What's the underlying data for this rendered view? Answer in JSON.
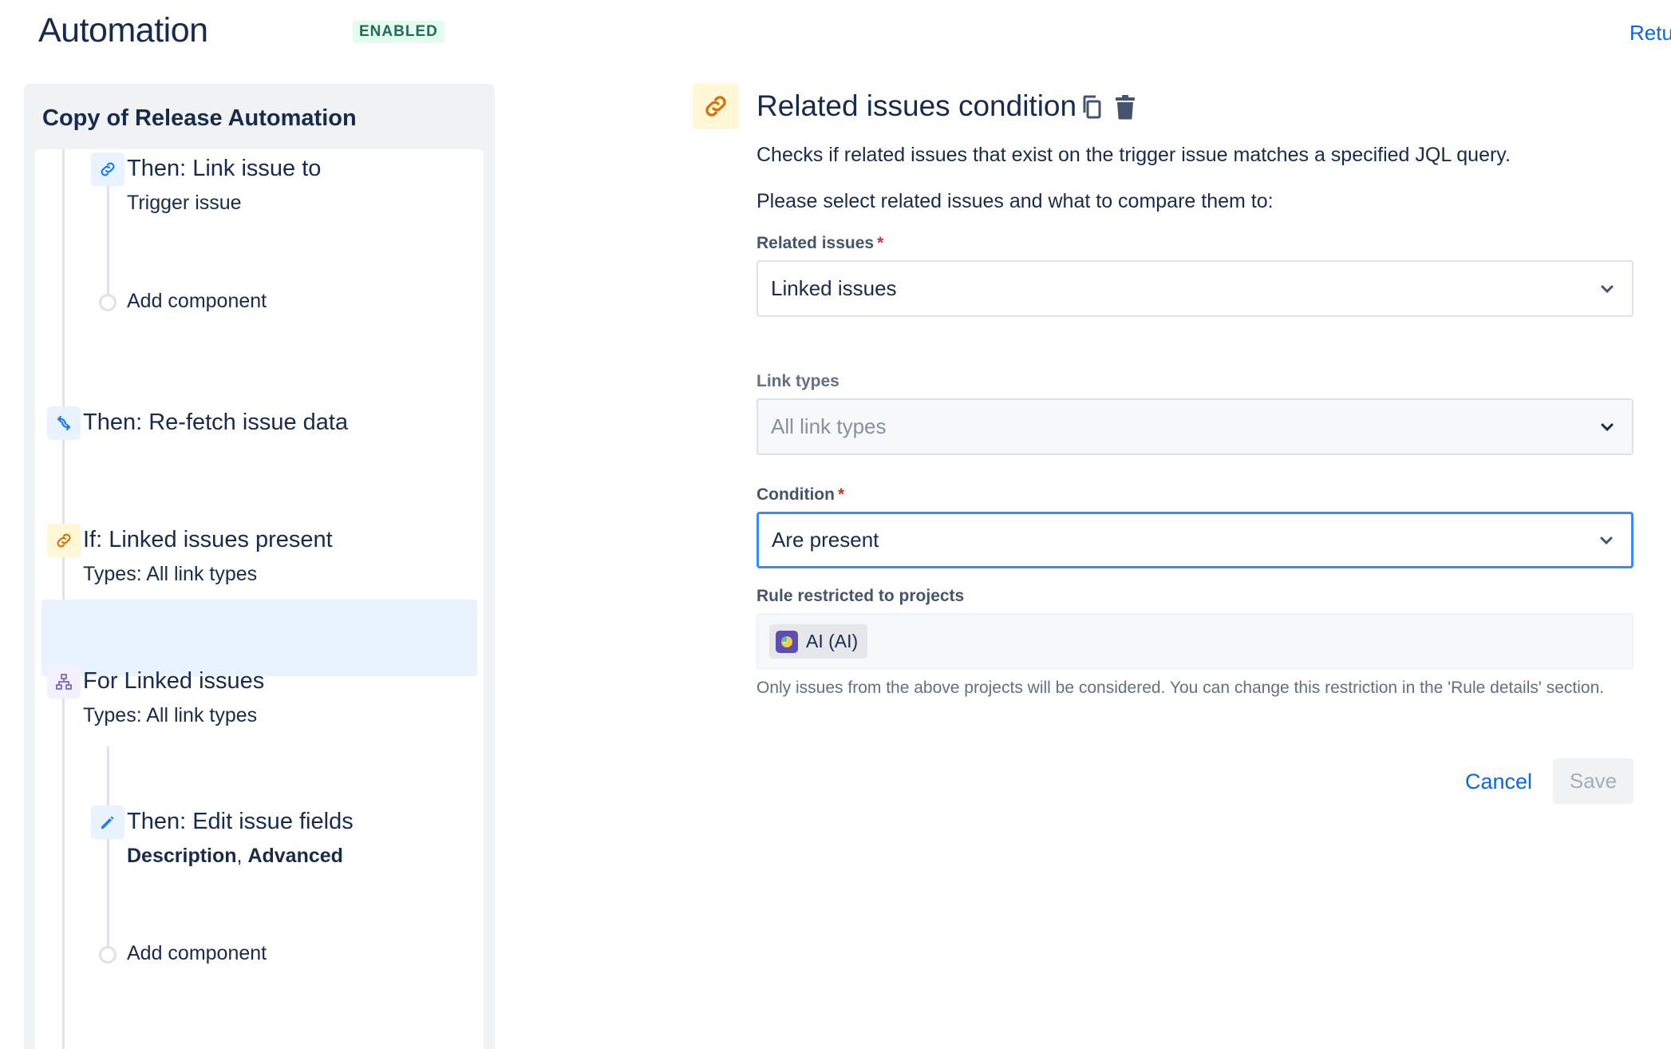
{
  "header": {
    "title": "Automation",
    "status_badge": "ENABLED",
    "return_link": "Retu"
  },
  "sidebar": {
    "rule_name": "Copy of Release Automation",
    "steps": [
      {
        "title": "Then: Link issue to",
        "subtitle": "Trigger issue",
        "icon": "link-icon"
      },
      {
        "title": "Add component",
        "icon": "add-dot"
      },
      {
        "title": "Then: Re-fetch issue data",
        "icon": "refresh-icon"
      },
      {
        "title": "If: Linked issues present",
        "subtitle": "Types: All link types",
        "icon": "link-icon",
        "selected": true
      },
      {
        "title": "For Linked issues",
        "subtitle": "Types: All link types",
        "icon": "branch-icon"
      },
      {
        "title": "Then: Edit issue fields",
        "subtitle_bold_1": "Description",
        "subtitle_sep": ", ",
        "subtitle_bold_2": "Advanced",
        "icon": "pencil-icon"
      },
      {
        "title": "Add component",
        "icon": "add-dot"
      }
    ]
  },
  "panel": {
    "title": "Related issues condition",
    "description": "Checks if related issues that exist on the trigger issue matches a specified JQL query.",
    "instruction": "Please select related issues and what to compare them to:",
    "related_issues": {
      "label": "Related issues",
      "required_mark": "*",
      "value": "Linked issues"
    },
    "link_types": {
      "label": "Link types",
      "value": "All link types"
    },
    "condition": {
      "label": "Condition",
      "required_mark": "*",
      "value": "Are present"
    },
    "projects": {
      "label": "Rule restricted to projects",
      "chip": "AI (AI)",
      "help": "Only issues from the above projects will be considered. You can change this restriction in the 'Rule details' section."
    },
    "buttons": {
      "cancel": "Cancel",
      "save": "Save"
    }
  },
  "colors": {
    "brand_blue": "#0c66e4",
    "focus_border": "#388bff",
    "selected_step_bg": "#e9f2ff",
    "condition_icon_bg": "#fff7d6",
    "condition_icon_fg": "#d97008",
    "enabled_badge_bg": "#e3fcef",
    "enabled_badge_fg": "#216e4e"
  }
}
